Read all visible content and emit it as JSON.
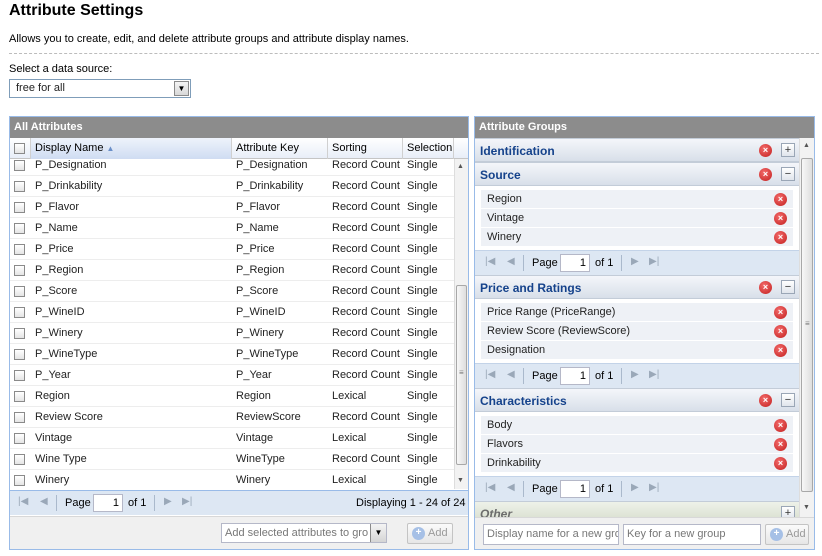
{
  "page": {
    "title": "Attribute Settings",
    "description": "Allows you to create, edit, and delete attribute groups and attribute display names."
  },
  "data_source": {
    "label": "Select a data source:",
    "selected": "free for all"
  },
  "all_attributes": {
    "title": "All Attributes",
    "columns": {
      "display_name": "Display Name",
      "attribute_key": "Attribute Key",
      "sorting": "Sorting",
      "selection": "Selection"
    },
    "rows": [
      {
        "name": "P_Designation",
        "key": "P_Designation",
        "sorting": "Record Count",
        "selection": "Single"
      },
      {
        "name": "P_Drinkability",
        "key": "P_Drinkability",
        "sorting": "Record Count",
        "selection": "Single"
      },
      {
        "name": "P_Flavor",
        "key": "P_Flavor",
        "sorting": "Record Count",
        "selection": "Single"
      },
      {
        "name": "P_Name",
        "key": "P_Name",
        "sorting": "Record Count",
        "selection": "Single"
      },
      {
        "name": "P_Price",
        "key": "P_Price",
        "sorting": "Record Count",
        "selection": "Single"
      },
      {
        "name": "P_Region",
        "key": "P_Region",
        "sorting": "Record Count",
        "selection": "Single"
      },
      {
        "name": "P_Score",
        "key": "P_Score",
        "sorting": "Record Count",
        "selection": "Single"
      },
      {
        "name": "P_WineID",
        "key": "P_WineID",
        "sorting": "Record Count",
        "selection": "Single"
      },
      {
        "name": "P_Winery",
        "key": "P_Winery",
        "sorting": "Record Count",
        "selection": "Single"
      },
      {
        "name": "P_WineType",
        "key": "P_WineType",
        "sorting": "Record Count",
        "selection": "Single"
      },
      {
        "name": "P_Year",
        "key": "P_Year",
        "sorting": "Record Count",
        "selection": "Single"
      },
      {
        "name": "Region",
        "key": "Region",
        "sorting": "Lexical",
        "selection": "Single"
      },
      {
        "name": "Review Score",
        "key": "ReviewScore",
        "sorting": "Record Count",
        "selection": "Single"
      },
      {
        "name": "Vintage",
        "key": "Vintage",
        "sorting": "Lexical",
        "selection": "Single"
      },
      {
        "name": "Wine Type",
        "key": "WineType",
        "sorting": "Record Count",
        "selection": "Single"
      },
      {
        "name": "Winery",
        "key": "Winery",
        "sorting": "Lexical",
        "selection": "Single"
      }
    ],
    "pager": {
      "page_label": "Page",
      "page_value": "1",
      "of_label": "of 1",
      "displaying": "Displaying 1 - 24 of 24"
    },
    "add_combo_placeholder": "Add selected attributes to gro",
    "add_label": "Add"
  },
  "attribute_groups": {
    "title": "Attribute Groups",
    "groups": [
      {
        "name": "Identification",
        "collapsed": true,
        "items": []
      },
      {
        "name": "Source",
        "collapsed": false,
        "items": [
          "Region",
          "Vintage",
          "Winery"
        ]
      },
      {
        "name": "Price and Ratings",
        "collapsed": false,
        "items": [
          "Price Range (PriceRange)",
          "Review Score (ReviewScore)",
          "Designation"
        ]
      },
      {
        "name": "Characteristics",
        "collapsed": false,
        "items": [
          "Body",
          "Flavors",
          "Drinkability"
        ]
      }
    ],
    "other_group": "Other",
    "pager": {
      "page_label": "Page",
      "page_value": "1",
      "of_label": "of 1"
    },
    "new_group_name_placeholder": "Display name for a new gro",
    "new_group_key_placeholder": "Key for a new group",
    "add_label": "Add"
  },
  "icons": {
    "delete": "x-circle-icon",
    "expand": "plus-icon",
    "collapse": "minus-icon",
    "first": "first-page-icon",
    "prev": "prev-page-icon",
    "next": "next-page-icon",
    "last": "last-page-icon"
  },
  "colors": {
    "panel_header": "#8c8c8c",
    "group_title": "#15428b",
    "delete_red": "#c2201f",
    "pager_bg": "#dde7f3"
  }
}
